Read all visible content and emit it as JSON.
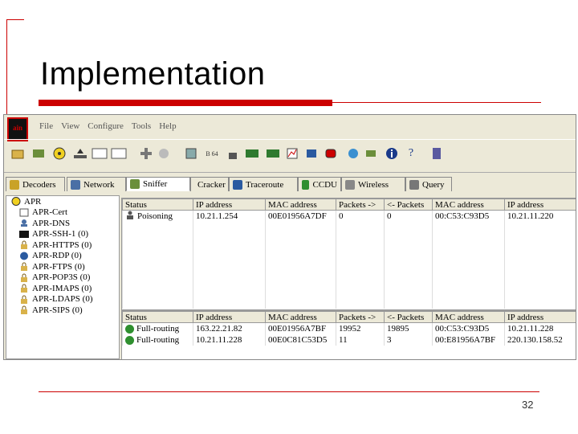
{
  "slide": {
    "title": "Implementation",
    "page_number": "32"
  },
  "app": {
    "logo_text": "ain",
    "menu": [
      "File",
      "View",
      "Configure",
      "Tools",
      "Help"
    ]
  },
  "toolbar": {
    "labels": [
      "B 64"
    ]
  },
  "tabs": [
    {
      "label": "Decoders",
      "icon": "decoder-icon",
      "color": "#c9a227"
    },
    {
      "label": "Network",
      "icon": "network-icon",
      "color": "#4a6fa5"
    },
    {
      "label": "Sniffer",
      "icon": "sniffer-icon",
      "color": "#6a8f3a"
    },
    {
      "label": "Cracker",
      "icon": "cracker-icon",
      "color": "#555555"
    },
    {
      "label": "Traceroute",
      "icon": "traceroute-icon",
      "color": "#2a5aa0"
    },
    {
      "label": "CCDU",
      "icon": "ccdu-icon",
      "color": "#2f8f2f"
    },
    {
      "label": "Wireless",
      "icon": "wireless-icon",
      "color": "#888888"
    },
    {
      "label": "Query",
      "icon": "query-icon",
      "color": "#777777"
    }
  ],
  "tree": [
    {
      "label": "APR",
      "level": 0
    },
    {
      "label": "APR-Cert",
      "level": 1
    },
    {
      "label": "APR-DNS",
      "level": 1
    },
    {
      "label": "APR-SSH-1 (0)",
      "level": 1
    },
    {
      "label": "APR-HTTPS (0)",
      "level": 1
    },
    {
      "label": "APR-RDP (0)",
      "level": 1
    },
    {
      "label": "APR-FTPS (0)",
      "level": 1
    },
    {
      "label": "APR-POP3S (0)",
      "level": 1
    },
    {
      "label": "APR-IMAPS (0)",
      "level": 1
    },
    {
      "label": "APR-LDAPS (0)",
      "level": 1
    },
    {
      "label": "APR-SIPS (0)",
      "level": 1
    }
  ],
  "top_table": {
    "headers": [
      "Status",
      "IP address",
      "MAC address",
      "Packets ->",
      "<- Packets",
      "MAC address",
      "IP address"
    ],
    "rows": [
      [
        "Poisoning",
        "10.21.1.254",
        "00E01956A7DF",
        "0",
        "0",
        "00:C53:C93D5",
        "10.21.11.220"
      ]
    ]
  },
  "bottom_table": {
    "headers": [
      "Status",
      "IP address",
      "MAC address",
      "Packets ->",
      "<- Packets",
      "MAC address",
      "IP address"
    ],
    "rows": [
      [
        "Full-routing",
        "163.22.21.82",
        "00E01956A7BF",
        "19952",
        "19895",
        "00:C53:C93D5",
        "10.21.11.228"
      ],
      [
        "Full-routing",
        "10.21.11.228",
        "00E0C81C53D5",
        "11",
        "3",
        "00:E81956A7BF",
        "220.130.158.52"
      ]
    ]
  }
}
